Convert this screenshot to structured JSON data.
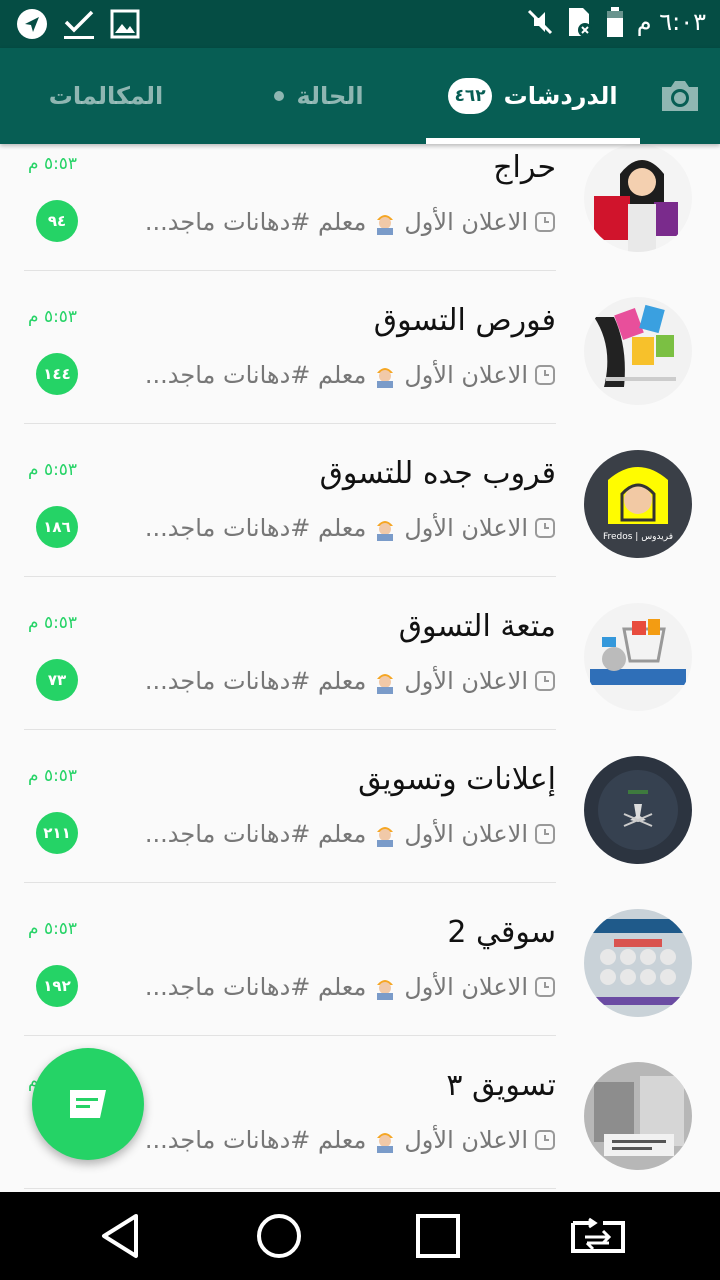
{
  "status_bar": {
    "time": "٦:٠٣ م",
    "icons": [
      "navigation-icon",
      "check-download-icon",
      "gallery-icon",
      "mute-icon",
      "sim-icon",
      "battery-icon"
    ]
  },
  "tabs": {
    "camera_icon": "camera-icon",
    "chats": {
      "label": "الدردشات",
      "badge": "٤٦٢"
    },
    "status": {
      "label": "الحالة"
    },
    "calls": {
      "label": "المكالمات"
    }
  },
  "chats": [
    {
      "name": "حراج",
      "time": "٥:٥٣ م",
      "preview": "الاعلان الأول",
      "preview_rest": "معلم #دهانات ماجد...",
      "unread": "٩٤"
    },
    {
      "name": "فورص التسوق",
      "time": "٥:٥٣ م",
      "preview": "الاعلان الأول",
      "preview_rest": "معلم #دهانات ماجد...",
      "unread": "١٤٤"
    },
    {
      "name": "قروب جده للتسوق",
      "time": "٥:٥٣ م",
      "preview": "الاعلان الأول",
      "preview_rest": "معلم #دهانات ماجد...",
      "unread": "١٨٦"
    },
    {
      "name": "متعة التسوق",
      "time": "٥:٥٣ م",
      "preview": "الاعلان الأول",
      "preview_rest": "معلم #دهانات ماجد...",
      "unread": "٧٣"
    },
    {
      "name": "إعلانات وتسويق",
      "time": "٥:٥٣ م",
      "preview": "الاعلان الأول",
      "preview_rest": "معلم #دهانات ماجد...",
      "unread": "٢١١"
    },
    {
      "name": "سوقي 2",
      "time": "٥:٥٣ م",
      "preview": "الاعلان الأول",
      "preview_rest": "معلم #دهانات ماجد...",
      "unread": "١٩٢"
    },
    {
      "name": "تسويق ٣",
      "time": "٥:٥٣ م",
      "preview": "الاعلان الأول",
      "preview_rest": "معلم #دهانات ماجد...",
      "unread": ""
    }
  ],
  "avatar_labels": {
    "chat3": "Fredos | فريدوس"
  },
  "fab": {
    "icon": "new-chat-icon"
  },
  "nav": {
    "icons": [
      "back-icon",
      "home-icon",
      "recents-icon",
      "rotate-screen-icon"
    ]
  },
  "colors": {
    "primary": "#075e54",
    "status_bar": "#054d44",
    "accent": "#25d366"
  }
}
